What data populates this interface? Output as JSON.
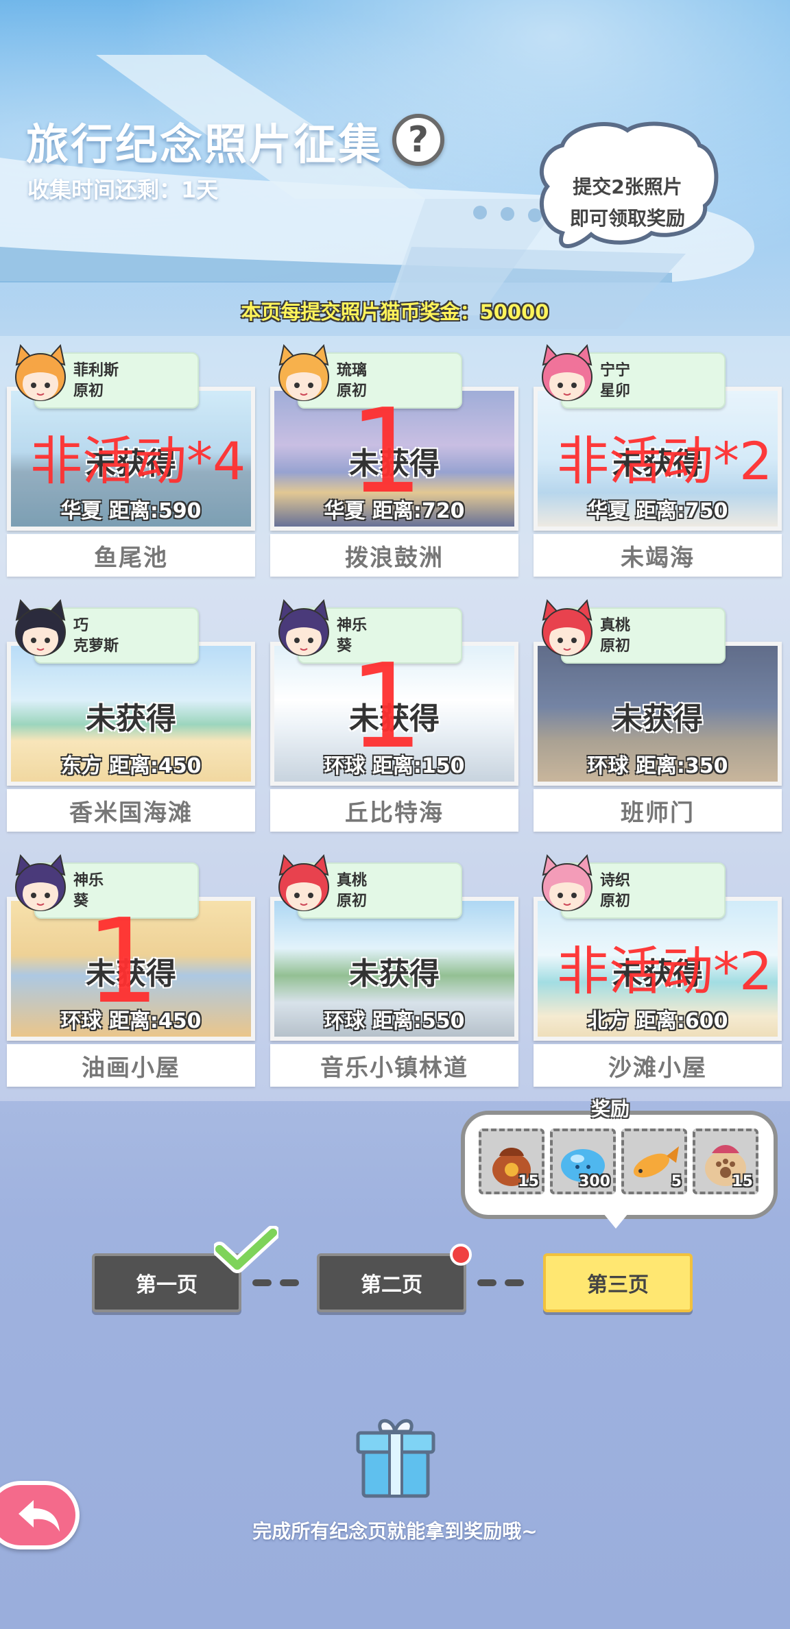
{
  "header": {
    "title": "旅行纪念照片征集",
    "help_label": "?",
    "time_remaining": "收集时间还剩：1天",
    "bubble_line1": "提交2张照片",
    "bubble_line2": "即可领取奖励",
    "page_reward": "本页每提交照片猫币奖金：50000"
  },
  "cards": [
    {
      "char_name": "菲利斯",
      "char_sub": "原初",
      "status": "未获得",
      "region_distance": "华夏  距离:590",
      "place": "鱼尾池",
      "overlay": "非活动*4",
      "hair": "#f6a545",
      "scene": "lake"
    },
    {
      "char_name": "琉璃",
      "char_sub": "原初",
      "status": "未获得",
      "region_distance": "华夏  距离:720",
      "place": "拨浪鼓洲",
      "overlay": "1",
      "hair": "#f7b14c",
      "scene": "city"
    },
    {
      "char_name": "宁宁",
      "char_sub": "星卯",
      "status": "未获得",
      "region_distance": "华夏  距离:750",
      "place": "未竭海",
      "overlay": "非活动*2",
      "hair": "#f0739a",
      "scene": "sea"
    },
    {
      "char_name": "巧",
      "char_sub": "克萝斯",
      "status": "未获得",
      "region_distance": "东方  距离:450",
      "place": "香米国海滩",
      "overlay": "",
      "hair": "#2b2b3d",
      "scene": "beach"
    },
    {
      "char_name": "神乐",
      "char_sub": "葵",
      "status": "未获得",
      "region_distance": "环球  距离:150",
      "place": "丘比特海",
      "overlay": "1",
      "hair": "#4a3a7a",
      "scene": "greek"
    },
    {
      "char_name": "真桃",
      "char_sub": "原初",
      "status": "未获得",
      "region_distance": "环球  距离:350",
      "place": "班师门",
      "overlay": "",
      "hair": "#e8424e",
      "scene": "arch"
    },
    {
      "char_name": "神乐",
      "char_sub": "葵",
      "status": "未获得",
      "region_distance": "环球  距离:450",
      "place": "油画小屋",
      "overlay": "1",
      "hair": "#4a3a7a",
      "scene": "house"
    },
    {
      "char_name": "真桃",
      "char_sub": "原初",
      "status": "未获得",
      "region_distance": "环球  距离:550",
      "place": "音乐小镇林道",
      "overlay": "",
      "hair": "#e8424e",
      "scene": "bridge"
    },
    {
      "char_name": "诗织",
      "char_sub": "原初",
      "status": "未获得",
      "region_distance": "北方  距离:600",
      "place": "沙滩小屋",
      "overlay": "非活动*2",
      "hair": "#f39cb8",
      "scene": "palm"
    }
  ],
  "rewards": {
    "label": "奖励",
    "items": [
      {
        "icon": "treasure-bag-icon",
        "count": "15"
      },
      {
        "icon": "blue-slime-icon",
        "count": "300"
      },
      {
        "icon": "fish-icon",
        "count": "5"
      },
      {
        "icon": "paw-bag-icon",
        "count": "15"
      }
    ]
  },
  "pages": [
    {
      "label": "第一页",
      "state": "completed"
    },
    {
      "label": "第二页",
      "state": "notify"
    },
    {
      "label": "第三页",
      "state": "active"
    }
  ],
  "footer": {
    "hint": "完成所有纪念页就能拿到奖励哦~",
    "back_icon": "back-arrow-icon",
    "gift_icon": "gift-icon"
  },
  "colors": {
    "tag_bg": "#e3f8e6",
    "active_page": "#ffe771",
    "overlay_red": "#ff3030"
  }
}
